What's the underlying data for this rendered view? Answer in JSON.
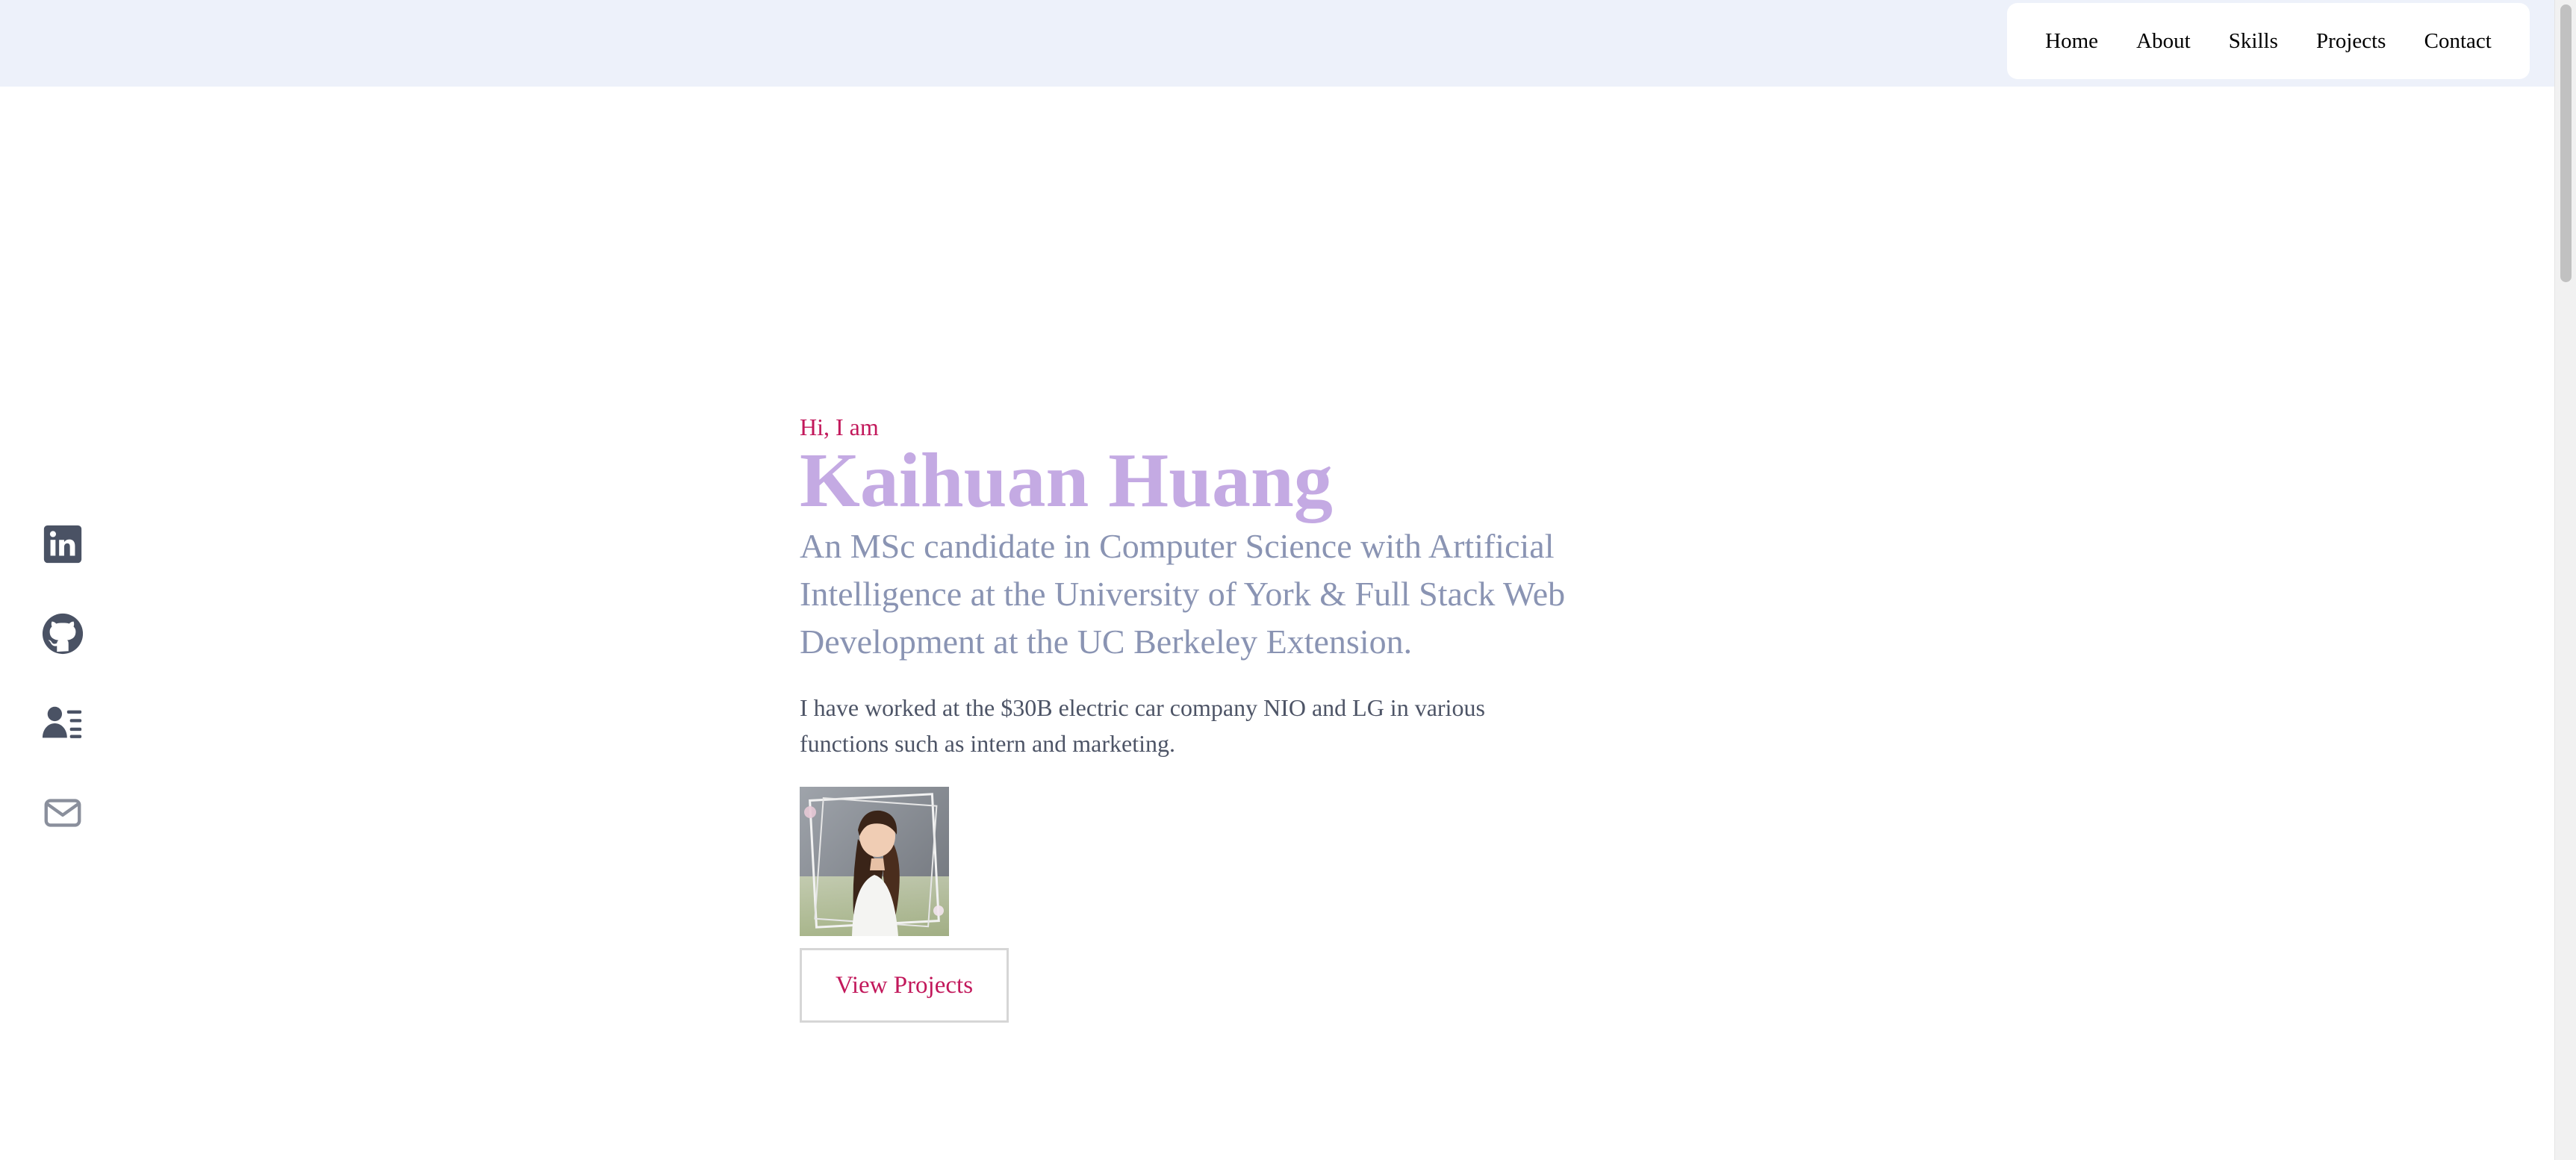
{
  "nav": {
    "items": [
      "Home",
      "About",
      "Skills",
      "Projects",
      "Contact"
    ]
  },
  "social": {
    "icons": [
      "linkedin-icon",
      "github-icon",
      "resume-icon",
      "email-icon"
    ]
  },
  "hero": {
    "greeting": "Hi, I am",
    "name": "Kaihuan Huang",
    "tagline": "An MSc candidate in Computer Science with Artificial Intelligence at the University of York & Full Stack Web Development at the UC Berkeley Extension.",
    "description": "I have worked at the $30B electric car company NIO and LG in various functions such as intern and marketing.",
    "button_label": "View Projects"
  },
  "colors": {
    "topbar_bg": "#edf1fa",
    "accent": "#c2185b",
    "name": "#c4aae3",
    "tagline": "#8a94b3",
    "icon": "#4a5264"
  }
}
